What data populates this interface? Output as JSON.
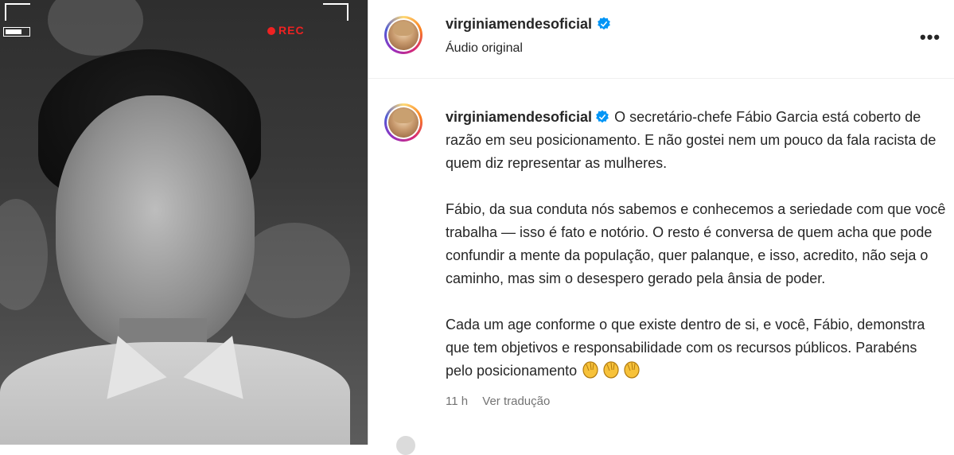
{
  "post": {
    "username": "virginiamendesoficial",
    "audio_label": "Áudio original",
    "more_label": "•••",
    "rec_label": "REC"
  },
  "caption": {
    "username": "virginiamendesoficial",
    "paragraph1": "O secretário-chefe Fábio Garcia está coberto de razão em seu posicionamento. E não gostei nem um pouco da fala racista de quem diz representar as mulheres.",
    "paragraph2": "Fábio, da sua conduta nós sabemos e conhecemos a seriedade com que você trabalha — isso é fato e notório. O resto é conversa de quem acha que pode confundir a mente da população, quer palanque, e isso, acredito, não seja o caminho, mas sim o desespero gerado pela ânsia de poder.",
    "paragraph3": "Cada um age conforme o que existe dentro de si, e você, Fábio, demonstra que tem objetivos e responsabilidade com os recursos públicos. Parabéns pelo posicionamento",
    "emoji": "clapping-hands-icon"
  },
  "meta": {
    "time": "11 h",
    "translate": "Ver tradução"
  },
  "colors": {
    "verified": "#0095f6",
    "text": "#262626",
    "muted": "#737373",
    "rec": "#ee2222"
  }
}
